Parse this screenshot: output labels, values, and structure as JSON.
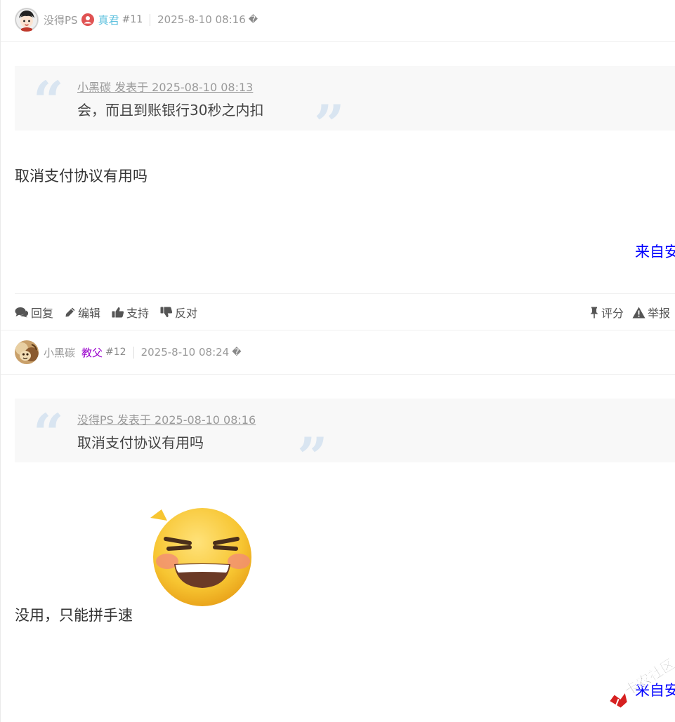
{
  "post11": {
    "user": "没得PS",
    "group": "真君",
    "group_color": "#5bc0de",
    "floor": "#11",
    "time": "2025-8-10 08:16",
    "device_icon": "�",
    "quote": {
      "author_line": "小黑碳 发表于 2025-08-10 08:13",
      "text": "会，而且到账银行30秒之内扣"
    },
    "message": "取消支付协议有用吗",
    "from_device": "来自安"
  },
  "actions": {
    "reply": "回复",
    "edit": "编辑",
    "support": "支持",
    "oppose": "反对",
    "rate": "评分",
    "report": "举报"
  },
  "post12": {
    "user": "小黑碳",
    "group": "教父",
    "group_color": "#9900cc",
    "floor": "#12",
    "time": "2025-8-10 08:24",
    "device_icon": "�",
    "quote": {
      "author_line": "没得PS 发表于 2025-08-10 08:16",
      "text": "取消支付协议有用吗"
    },
    "message": "没用，只能拼手速",
    "from_device": "来自安"
  },
  "watermark": "卡农社区",
  "colors": {
    "quote_bg": "#f8f8f8",
    "quote_mark": "#d9e5f1",
    "link_blue": "#0000ff",
    "text": "#333333",
    "muted": "#999999"
  }
}
